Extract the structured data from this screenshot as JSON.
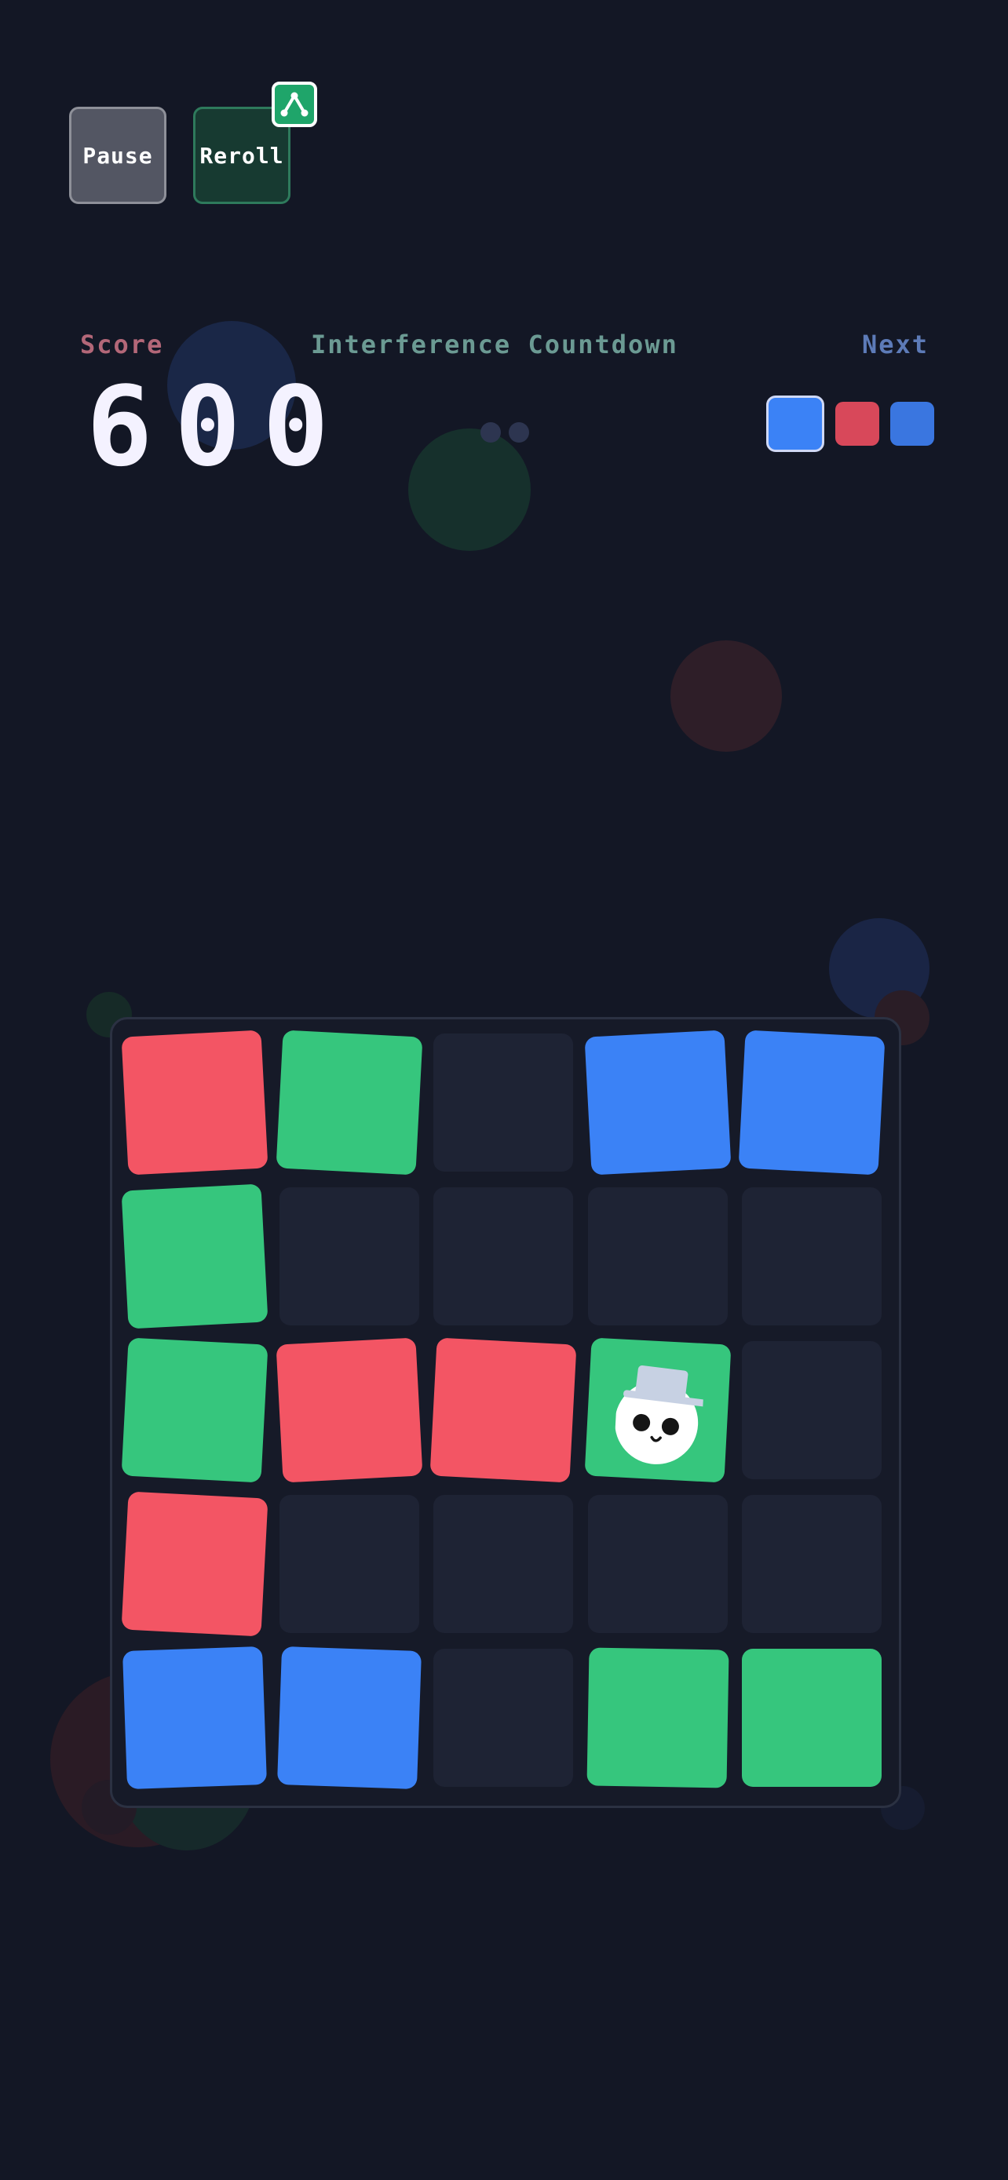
{
  "controls": {
    "pause_label": "Pause",
    "reroll_label": "Reroll",
    "reroll_badge_icon": "share-icon"
  },
  "hud": {
    "score_label": "Score",
    "score_value": "600",
    "countdown_label": "Interference Countdown",
    "countdown_remaining": 2,
    "next_label": "Next",
    "next_queue": [
      "blue",
      "red",
      "blue"
    ]
  },
  "board": {
    "size": 5,
    "rows": [
      [
        "red",
        "green",
        "empty",
        "blue",
        "blue"
      ],
      [
        "green",
        "empty",
        "empty",
        "empty",
        "empty"
      ],
      [
        "green",
        "red",
        "red",
        "green",
        "empty"
      ],
      [
        "red",
        "empty",
        "empty",
        "empty",
        "empty"
      ],
      [
        "blue",
        "blue",
        "empty",
        "green",
        "green"
      ]
    ],
    "character": {
      "row": 2,
      "col": 3,
      "icon": "top-hat-ghost-icon"
    }
  },
  "colors": {
    "background": "#131725",
    "red": "#f35564",
    "green": "#36c67d",
    "blue": "#3b82f6",
    "empty": "#1e2334"
  }
}
